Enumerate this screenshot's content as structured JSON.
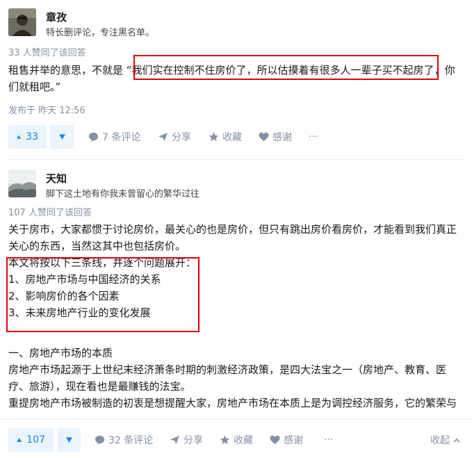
{
  "answers": [
    {
      "author": {
        "name": "章孜",
        "bio": "特长删评论，专注黑名单。"
      },
      "votes_text": "33 人赞同了该回答",
      "body": {
        "line1_prefix": "租售并举的意思，不就是 “",
        "line1_highlight": "我们实在控制不住房价了，所以估摸着有很多人一辈子买不起房了",
        "line1_suffix": "，你",
        "line2": "们就租吧。”"
      },
      "published": "发布于 昨天 12:56",
      "actions": {
        "upvote_count": "33",
        "comments": "7 条评论",
        "share": "分享",
        "favorite": "收藏",
        "thanks": "感谢",
        "more": "···"
      }
    },
    {
      "author": {
        "name": "天知",
        "bio": "脚下这土地有你我未曾留心的繁华过往"
      },
      "votes_text": "107 人赞同了该回答",
      "body": {
        "p1": "关于房市，大家都惯于讨论房价，最关心的也是房价，但只有跳出房价看房价，才能看到我们真正关心的东西，当然这其中也包括房价。",
        "intro": "本文将按以下三条线，并逐个问题展开：",
        "list": [
          "1、房地产市场与中国经济的关系",
          "2、影响房价的各个因素",
          "3、未来房地产行业的变化发展"
        ],
        "section_title": "一、房地产市场的本质",
        "p2": "房地产市场起源于上世纪末经济萧条时期的刺激经济政策，是四大法宝之一（房地产、教育、医疗、旅游），现在看也是最赚钱的法宝。",
        "p3": "重提房地产市场被制造的初衷是想提醒大家，房地产市场在本质上是为调控经济服务，它的繁荣与"
      },
      "actions": {
        "upvote_count": "107",
        "comments": "32 条评论",
        "share": "分享",
        "favorite": "收藏",
        "thanks": "感谢",
        "more": "···",
        "collapse": "收起"
      }
    }
  ],
  "colors": {
    "accent": "#0f88eb",
    "muted": "#8590a6",
    "highlight_box": "#e0000b",
    "vote_bg": "#ebf3fb"
  }
}
